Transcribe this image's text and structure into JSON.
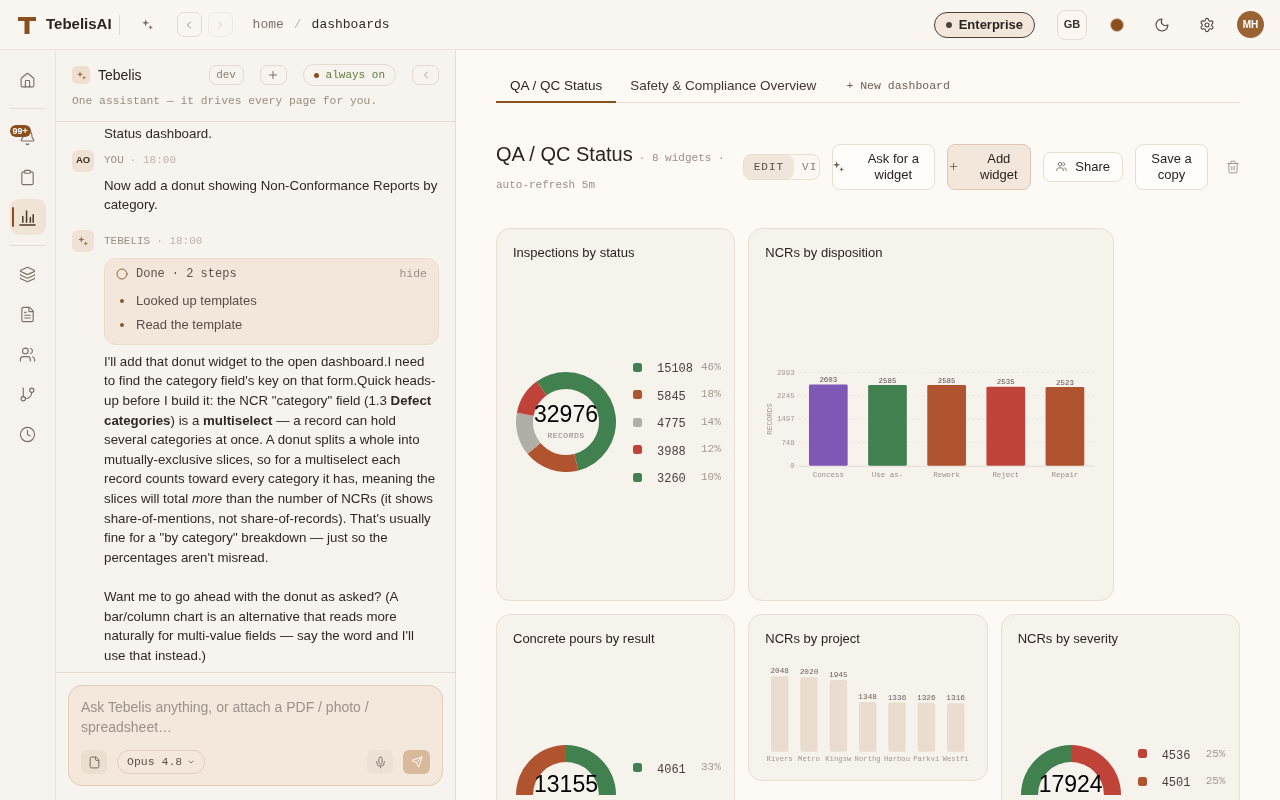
{
  "topbar": {
    "brand": "TebelisAI",
    "nav": [
      {
        "kind": "back",
        "disabled": false
      },
      {
        "kind": "forward",
        "disabled": true
      }
    ],
    "breadcrumb": [
      "home",
      "dashboards"
    ],
    "breadcrumb_separator": "/",
    "plan": "Enterprise",
    "region": "GB",
    "avatar": "MH"
  },
  "rail": {
    "groups": [
      [
        {
          "kind": "home",
          "selected": false
        }
      ],
      [
        {
          "kind": "bell",
          "selected": false,
          "badge": "99+"
        },
        {
          "kind": "clipboard",
          "selected": false
        },
        {
          "kind": "chart",
          "selected": true
        }
      ],
      [
        {
          "kind": "layers",
          "selected": false
        },
        {
          "kind": "document",
          "selected": false
        },
        {
          "kind": "users",
          "selected": false
        },
        {
          "kind": "branch",
          "selected": false
        },
        {
          "kind": "clock",
          "selected": false
        }
      ]
    ]
  },
  "assistant": {
    "name": "Tebelis",
    "env": "dev",
    "status": "always on",
    "subtitle": "One assistant — it drives every page for you.",
    "messages": [
      {
        "kind": "fragment",
        "text": "Status dashboard."
      },
      {
        "kind": "user",
        "avatar": "AO",
        "author": "YOU",
        "time": "· 18:00",
        "paragraphs": [
          "Now add a donut showing Non-Conformance Reports by category."
        ]
      },
      {
        "kind": "assistant",
        "author": "TEBELIS",
        "time": "· 18:00",
        "steps": {
          "status": "Done",
          "count": "· 2 steps",
          "toggle": "hide",
          "items": [
            "Looked up templates",
            "Read the template"
          ]
        },
        "paragraphs": [
          "I'll add that donut widget to the open dashboard.I need to find the category field's key on that form.Quick heads-up before I build it: the NCR \"category\" field (1.3 **Defect categories**) is a **multiselect** — a record can hold several categories at once. A donut splits a whole into mutually-exclusive slices, so for a multiselect each record counts toward every category it has, meaning the slices will total *more* than the number of NCRs (it shows share-of-mentions, not share-of-records). That's usually fine for a \"by category\" breakdown — just so the percentages aren't misread.",
          "Want me to go ahead with the donut as asked? (A bar/column chart is an alternative that reads more naturally for multi-value fields — say the word and I'll use that instead.)"
        ]
      }
    ],
    "composer": {
      "placeholder": "Ask Tebelis anything, or attach a PDF / photo / spreadsheet…",
      "model": "Opus 4.8"
    }
  },
  "dashboard": {
    "tabs": [
      {
        "label": "QA / QC Status",
        "selected": true
      },
      {
        "label": "Safety & Compliance Overview",
        "selected": false
      }
    ],
    "new_tab": "+ New dashboard",
    "title": "QA / QC Status",
    "widget_count": "· 8 widgets ·",
    "refresh": "auto-refresh 5m",
    "modes": [
      {
        "label": "EDIT",
        "selected": true
      },
      {
        "label": "VI",
        "selected": false
      }
    ],
    "actions": [
      {
        "kind": "ask",
        "label": "Ask for a widget",
        "primary": false
      },
      {
        "kind": "add",
        "label": "Add widget",
        "primary": true
      },
      {
        "kind": "share",
        "label": "Share",
        "primary": false
      },
      {
        "kind": "copy",
        "label": "Save a copy",
        "primary": false
      },
      {
        "kind": "delete"
      }
    ],
    "widgets": [
      {
        "kind": "donut",
        "title": "Inspections by status",
        "total": "32976",
        "total_label": "RECORDS",
        "legend": [
          {
            "value": "15108",
            "percent": "46%",
            "color": "#41804f"
          },
          {
            "value": "5845",
            "percent": "18%",
            "color": "#b0532f"
          },
          {
            "value": "4775",
            "percent": "14%",
            "color": "#b1ada7"
          },
          {
            "value": "3988",
            "percent": "12%",
            "color": "#c0433a"
          },
          {
            "value": "3260",
            "percent": "10%",
            "color": "#41804f"
          }
        ],
        "chart_data": {
          "type": "donut",
          "values": [
            46,
            18,
            14,
            12,
            10
          ]
        }
      },
      {
        "kind": "bar",
        "title": "NCRs by disposition",
        "bars": [
          {
            "color": "#7f57b5"
          },
          {
            "color": "#41804f"
          },
          {
            "color": "#b0532f"
          },
          {
            "color": "#c0433a"
          },
          {
            "color": "#b0532f"
          }
        ],
        "chart_data": {
          "type": "bar",
          "ylabel": "RECORDS",
          "categories": [
            "Concess",
            "Use as-",
            "Rework",
            "Reject",
            "Repair"
          ],
          "values": [
            2603,
            2585,
            2585,
            2535,
            2523
          ],
          "ylim": [
            0,
            2993
          ],
          "yticks": [
            0,
            748,
            1497,
            2245,
            2993
          ],
          "grid": true,
          "data_labels": true
        }
      },
      {
        "kind": "donut_partial",
        "title": "Concrete pours by result",
        "total": "13155",
        "slices": [
          {
            "color": "#41804f"
          },
          {
            "color": "#b0532f"
          }
        ],
        "legend": [
          {
            "value": "4061",
            "percent": "33%",
            "color": "#41804f"
          }
        ]
      },
      {
        "kind": "column",
        "title": "NCRs by project",
        "chart_data": {
          "type": "bar",
          "categories": [
            "Rivers",
            "Metro",
            "Kingsw",
            "Northg",
            "Harbou",
            "Parkvi",
            "Westfi"
          ],
          "values": [
            2048,
            2020,
            1945,
            1348,
            1336,
            1326,
            1316
          ],
          "data_labels": true
        }
      },
      {
        "kind": "donut_partial",
        "title": "NCRs by severity",
        "total": "17924",
        "slices": [
          {
            "color": "#c0433a"
          },
          {
            "color": "#41804f"
          }
        ],
        "legend": [
          {
            "value": "4536",
            "percent": "25%",
            "color": "#c0433a"
          },
          {
            "value": "4501",
            "percent": "25%",
            "color": "#b0532f"
          }
        ]
      }
    ]
  }
}
